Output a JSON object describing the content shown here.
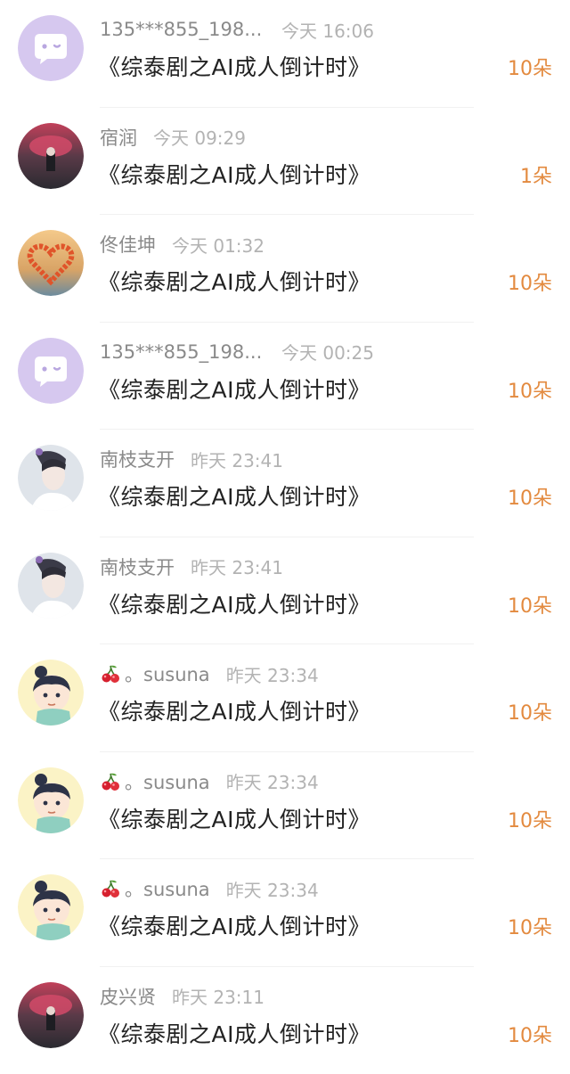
{
  "gift_list": [
    {
      "username": "135***855_198...",
      "time": "今天 16:06",
      "title": "《综泰剧之AI成人倒计时》",
      "count": "10朵",
      "avatar": "default-avatar"
    },
    {
      "username": "宿润",
      "time": "今天 09:29",
      "title": "《综泰剧之AI成人倒计时》",
      "count": "1朵",
      "avatar": "photo-avatar"
    },
    {
      "username": "佟佳坤",
      "time": "今天 01:32",
      "title": "《综泰剧之AI成人倒计时》",
      "count": "10朵",
      "avatar": "heart-avatar"
    },
    {
      "username": "135***855_198...",
      "time": "今天 00:25",
      "title": "《综泰剧之AI成人倒计时》",
      "count": "10朵",
      "avatar": "default-avatar"
    },
    {
      "username": "南枝支开",
      "time": "昨天 23:41",
      "title": "《综泰剧之AI成人倒计时》",
      "count": "10朵",
      "avatar": "portrait-avatar"
    },
    {
      "username": "南枝支开",
      "time": "昨天 23:41",
      "title": "《综泰剧之AI成人倒计时》",
      "count": "10朵",
      "avatar": "portrait-avatar"
    },
    {
      "username": "。susuna",
      "time": "昨天 23:34",
      "title": "《综泰剧之AI成人倒计时》",
      "count": "10朵",
      "avatar": "cartoon-avatar",
      "prefix_icon": "cherry-icon"
    },
    {
      "username": "。susuna",
      "time": "昨天 23:34",
      "title": "《综泰剧之AI成人倒计时》",
      "count": "10朵",
      "avatar": "cartoon-avatar",
      "prefix_icon": "cherry-icon"
    },
    {
      "username": "。susuna",
      "time": "昨天 23:34",
      "title": "《综泰剧之AI成人倒计时》",
      "count": "10朵",
      "avatar": "cartoon-avatar",
      "prefix_icon": "cherry-icon"
    },
    {
      "username": "皮兴贤",
      "time": "昨天 23:11",
      "title": "《综泰剧之AI成人倒计时》",
      "count": "10朵",
      "avatar": "photo-avatar"
    }
  ],
  "colors": {
    "username": "#8a8a8a",
    "time": "#b3b3b3",
    "title": "#222222",
    "count": "#e38a3f",
    "default_avatar_bg": "#d6c8ef"
  }
}
